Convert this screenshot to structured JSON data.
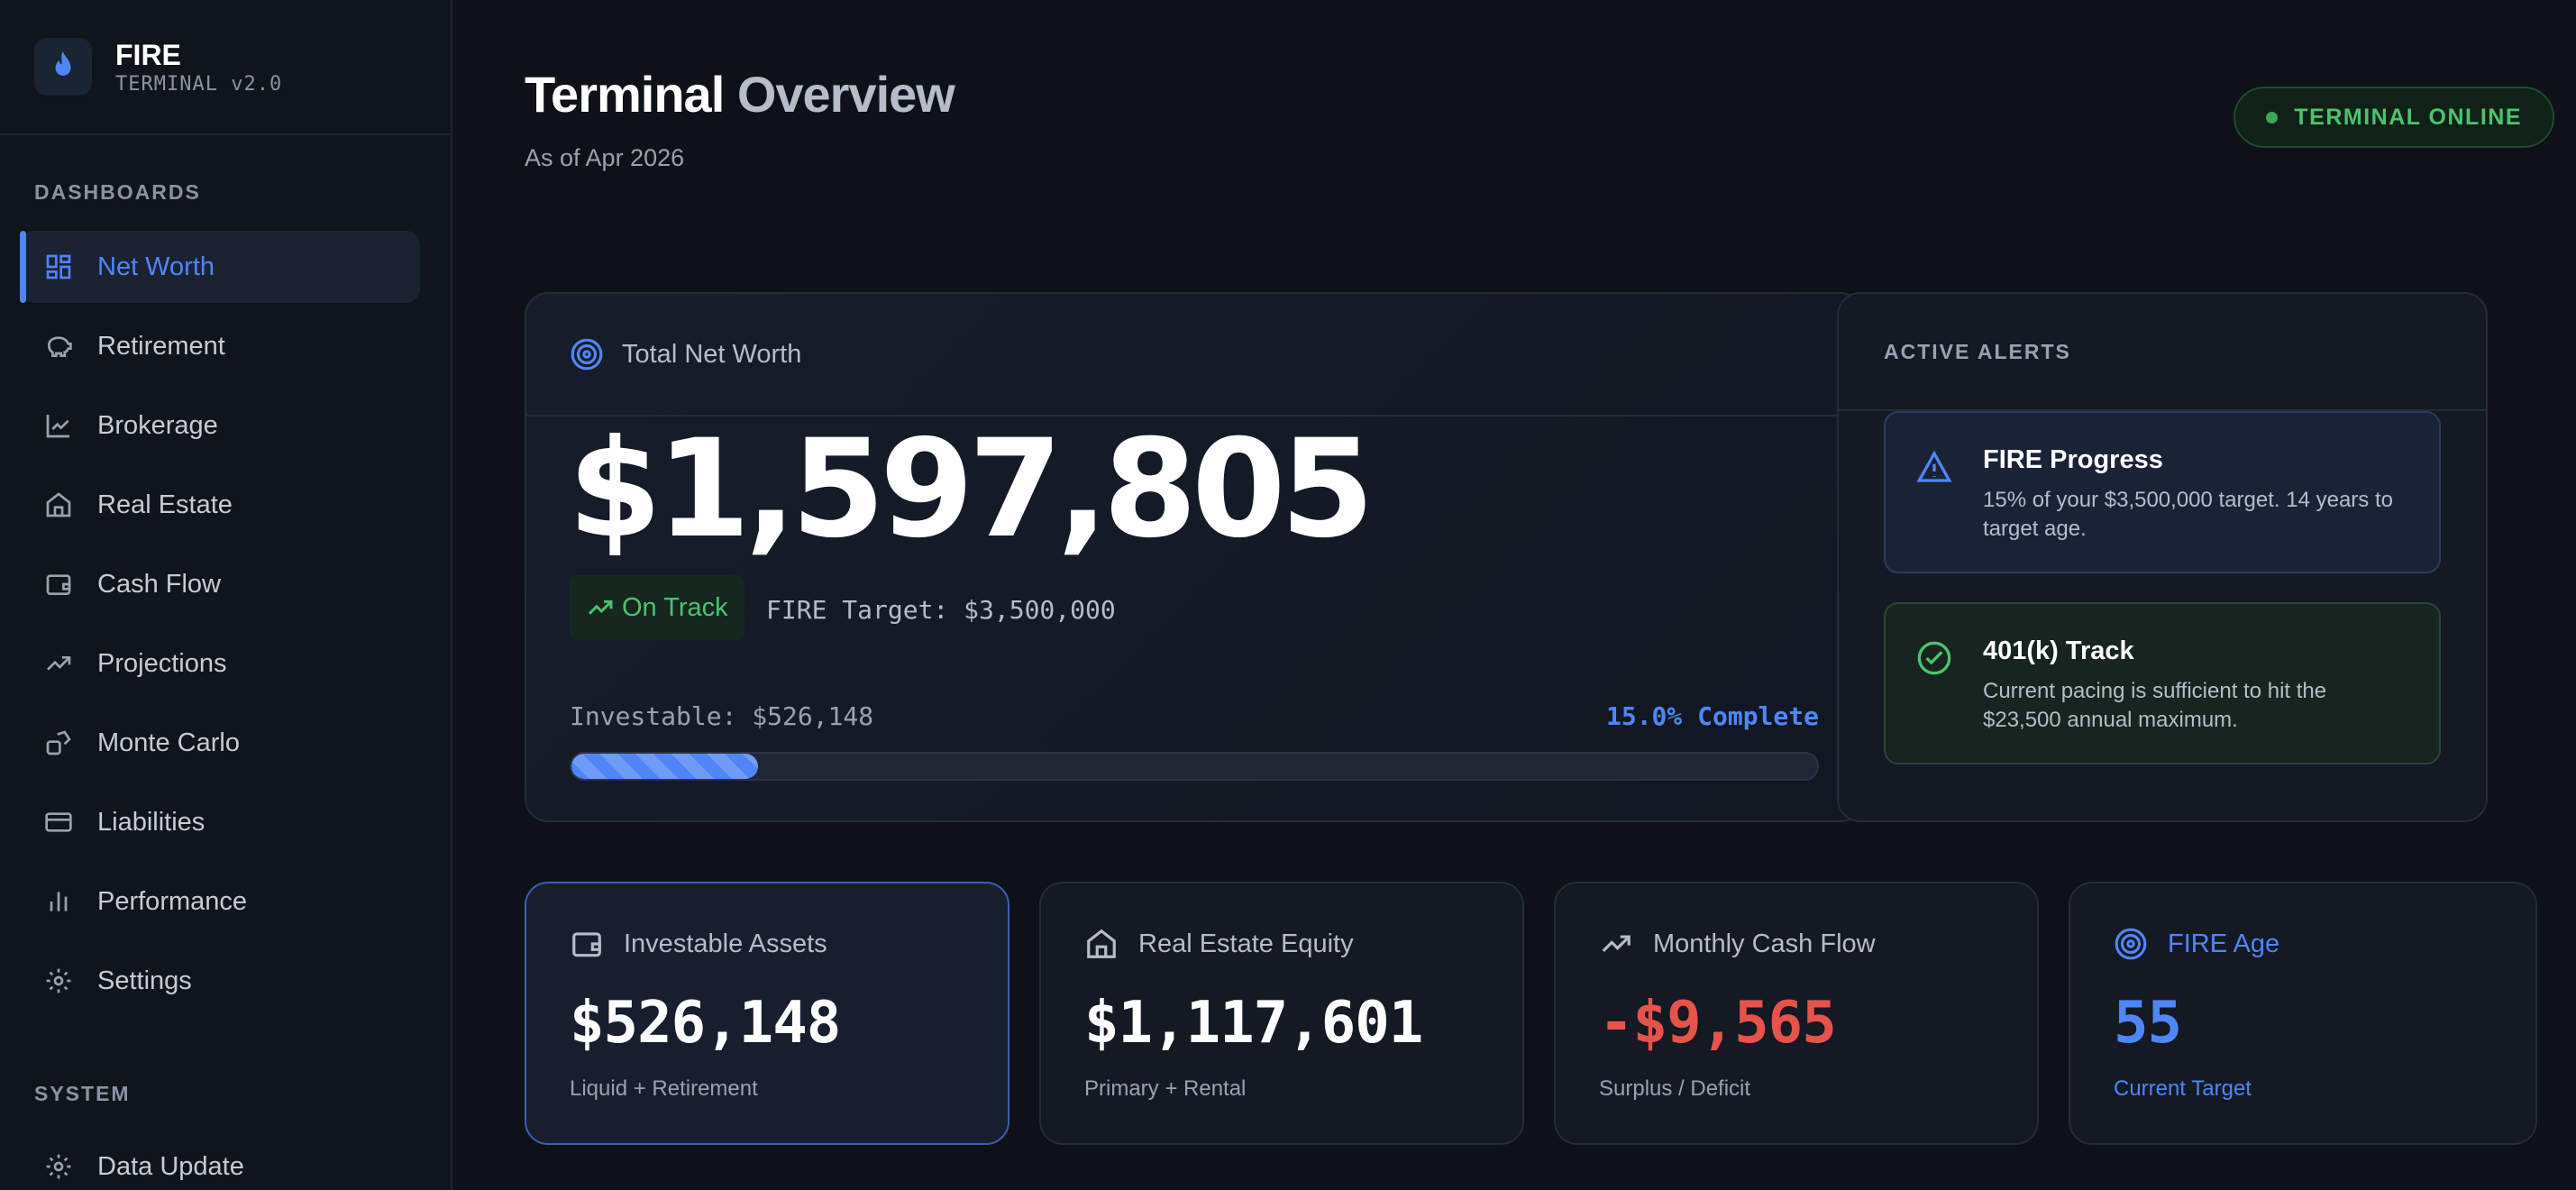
{
  "brand": {
    "name": "FIRE",
    "sub": "TERMINAL v2.0"
  },
  "sidebar": {
    "dashboards_label": "DASHBOARDS",
    "items": [
      {
        "label": "Net Worth",
        "icon": "grid-icon",
        "active": true
      },
      {
        "label": "Retirement",
        "icon": "piggy-bank-icon"
      },
      {
        "label": "Brokerage",
        "icon": "line-chart-icon"
      },
      {
        "label": "Real Estate",
        "icon": "home-icon"
      },
      {
        "label": "Cash Flow",
        "icon": "wallet-icon"
      },
      {
        "label": "Projections",
        "icon": "trending-up-icon"
      },
      {
        "label": "Monte Carlo",
        "icon": "dice-icon"
      },
      {
        "label": "Liabilities",
        "icon": "credit-card-icon"
      },
      {
        "label": "Performance",
        "icon": "bar-chart-icon"
      },
      {
        "label": "Settings",
        "icon": "gear-icon"
      }
    ],
    "system_label": "SYSTEM",
    "system_items": [
      {
        "label": "Data Update",
        "icon": "gear-icon"
      }
    ]
  },
  "header": {
    "title_a": "Terminal",
    "title_b": "Overview",
    "subtitle": "As of Apr 2026",
    "status": "TERMINAL ONLINE"
  },
  "net_worth": {
    "label": "Total Net Worth",
    "value": "$1,597,805",
    "badge": "On Track",
    "target": "FIRE Target: $3,500,000",
    "investable": "Investable: $526,148",
    "complete": "15.0% Complete",
    "progress_fraction": 0.15
  },
  "alerts": {
    "label": "ACTIVE ALERTS",
    "items": [
      {
        "title": "FIRE Progress",
        "desc": "15% of your $3,500,000 target. 14 years to target age."
      },
      {
        "title": "401(k) Track",
        "desc": "Current pacing is sufficient to hit the $23,500 annual maximum."
      }
    ]
  },
  "stats": [
    {
      "label": "Investable Assets",
      "value": "$526,148",
      "sub": "Liquid + Retirement"
    },
    {
      "label": "Real Estate Equity",
      "value": "$1,117,601",
      "sub": "Primary + Rental"
    },
    {
      "label": "Monthly Cash Flow",
      "value": "-$9,565",
      "sub": "Surplus / Deficit"
    },
    {
      "label": "FIRE Age",
      "value": "55",
      "sub": "Current Target"
    }
  ],
  "colors": {
    "accent": "#4f86f7",
    "success": "#4ec26e",
    "danger": "#e5534b",
    "bg": "#0e1117"
  }
}
